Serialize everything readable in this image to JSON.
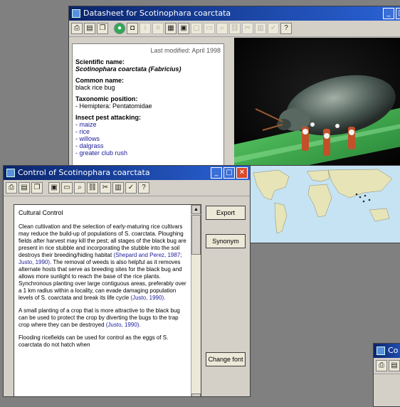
{
  "datasheet": {
    "title": "Datasheet for Scotinophara coarctata",
    "last_modified": "Last modified: April 1998",
    "sci_label": "Scientific name:",
    "sci_value": "Scotinophara coarctata (Fabricius)",
    "common_label": "Common name:",
    "common_value": "black rice bug",
    "tax_label": "Taxonomic position:",
    "tax_value": "- Hemiptera: Pentatomidae",
    "pest_label": "Insect pest attacking:",
    "hosts": [
      "- maize",
      "- rice",
      "- willows",
      "- dalgrass",
      "- greater club rush"
    ]
  },
  "control": {
    "title": "Control of Scotinophara coarctata",
    "heading": "Cultural Control",
    "para1": "Clean cultivation and the selection of early-maturing rice cultivars may reduce the build-up of populations of S. coarctata. Ploughing fields after harvest may kill the pest; all stages of the black bug are present in rice stubble and incorporating the stubble into the soil destroys their breeding/hiding habitat",
    "cite1": "(Shepard and Perez, 1987; Justo, 1990).",
    "para1b": "The removal of weeds is also helpful as it removes alternate hosts that serve as breeding sites for the black bug and allows more sunlight to reach the base of the rice plants. Synchronous planting over large contiguous areas, preferably over a 1 km radius within a locality, can evade damaging population levels of S. coarctata and break its life cycle",
    "cite2": "(Justo, 1990).",
    "para2": "A small planting of a crop that is more attractive to the black bug can be used to protect the crop by diverting the bugs to the trap crop where they can be destroyed",
    "cite3": "(Justo, 1990).",
    "para3": "Flooding ricefields can be used for control as the eggs of S. coarctata do not hatch when",
    "btn_export": "Export",
    "btn_synonym": "Synonym",
    "btn_change": "Change font"
  },
  "small": {
    "title": "Co"
  }
}
